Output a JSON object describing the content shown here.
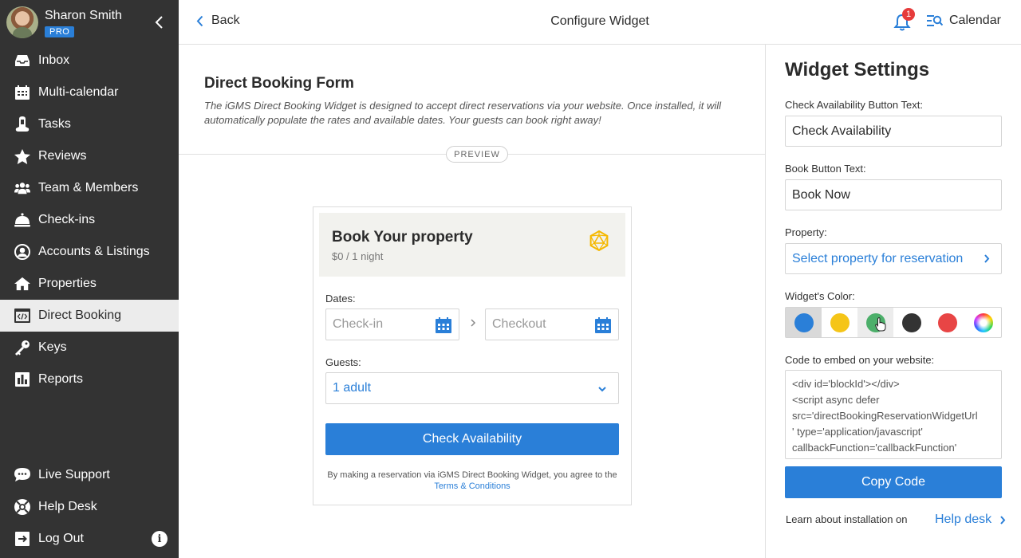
{
  "user": {
    "name": "Sharon Smith",
    "badge": "PRO"
  },
  "sidebar": {
    "items": [
      {
        "label": "Inbox",
        "icon": "inbox-icon"
      },
      {
        "label": "Multi-calendar",
        "icon": "calendar-grid-icon"
      },
      {
        "label": "Tasks",
        "icon": "tasks-icon"
      },
      {
        "label": "Reviews",
        "icon": "star-icon"
      },
      {
        "label": "Team & Members",
        "icon": "team-icon"
      },
      {
        "label": "Check-ins",
        "icon": "bell-service-icon"
      },
      {
        "label": "Accounts & Listings",
        "icon": "account-icon"
      },
      {
        "label": "Properties",
        "icon": "home-icon"
      },
      {
        "label": "Direct Booking",
        "icon": "code-window-icon",
        "active": true
      },
      {
        "label": "Keys",
        "icon": "key-icon"
      },
      {
        "label": "Reports",
        "icon": "reports-icon"
      }
    ],
    "bottom": [
      {
        "label": "Live Support",
        "icon": "chat-icon"
      },
      {
        "label": "Help Desk",
        "icon": "lifebuoy-icon"
      },
      {
        "label": "Log Out",
        "icon": "logout-icon"
      }
    ]
  },
  "topbar": {
    "back_label": "Back",
    "title": "Configure Widget",
    "notification_count": "1",
    "calendar_label": "Calendar"
  },
  "main": {
    "title": "Direct Booking Form",
    "description": "The iGMS Direct Booking Widget is designed to accept direct reservations via your website. Once installed, it will automatically populate the rates and available dates. Your guests can book right away!",
    "preview_label": "PREVIEW"
  },
  "widget": {
    "title": "Book Your property",
    "price": "$0 / 1 night",
    "dates_label": "Dates:",
    "checkin_placeholder": "Check-in",
    "checkout_placeholder": "Checkout",
    "guests_label": "Guests:",
    "guests_value": "1 adult",
    "button_label": "Check Availability",
    "terms_prefix": "By making a reservation via iGMS Direct Booking Widget, you agree to the",
    "terms_link": "Terms & Conditions"
  },
  "settings": {
    "title": "Widget Settings",
    "check_label": "Check Availability Button Text:",
    "check_value": "Check Availability",
    "book_label": "Book Button Text:",
    "book_value": "Book Now",
    "property_label": "Property:",
    "property_value": "Select property for reservation",
    "color_label": "Widget's Color:",
    "colors": [
      "#2a7fd8",
      "#f5c518",
      "#4caf6a",
      "#333333",
      "#e84545",
      "rainbow"
    ],
    "code_label": "Code to embed on your website:",
    "code_lines": [
      "<div id='blockId'></div>",
      "<script async defer",
      "src='directBookingReservationWidgetUrl",
      "' type='application/javascript'",
      " callbackFunction='callbackFunction'"
    ],
    "copy_label": "Copy Code",
    "learn_text": "Learn about installation on",
    "help_link": "Help desk"
  }
}
